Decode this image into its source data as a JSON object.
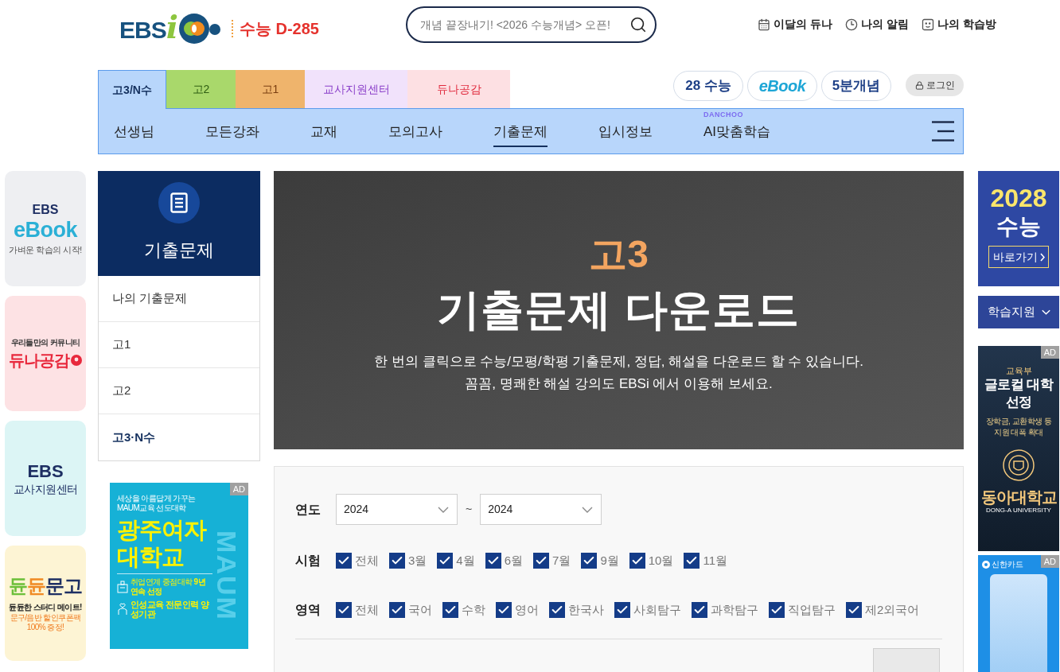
{
  "header": {
    "logo": {
      "letters": "EBS",
      "accent": "i"
    },
    "dday": "수능 D-285",
    "search": {
      "placeholder": "개념 끝장내기! <2026 수능개념> 오픈!"
    },
    "links": [
      {
        "label": "이달의 듀나"
      },
      {
        "label": "나의 알림"
      },
      {
        "label": "나의 학습방"
      }
    ]
  },
  "grade_tabs": [
    {
      "label": "고3/N수",
      "selected": true,
      "color": "#b8d6fb"
    },
    {
      "label": "고2",
      "selected": false,
      "color": "#a9d86b"
    },
    {
      "label": "고1",
      "selected": false,
      "color": "#efb46c"
    },
    {
      "label": "교사지원센터",
      "selected": false,
      "color": "#f1e2fb"
    },
    {
      "label": "듀나공감",
      "selected": false,
      "color": "#fde0e3"
    }
  ],
  "shortcuts": [
    {
      "kind": "text",
      "label": "28 수능"
    },
    {
      "kind": "logo",
      "label": "eBook"
    },
    {
      "kind": "text",
      "label": "5분개념"
    }
  ],
  "login": {
    "label": "로그인"
  },
  "main_nav": [
    {
      "label": "선생님",
      "selected": false
    },
    {
      "label": "모든강좌",
      "selected": false
    },
    {
      "label": "교재",
      "selected": false
    },
    {
      "label": "모의고사",
      "selected": false
    },
    {
      "label": "기출문제",
      "selected": true
    },
    {
      "label": "입시정보",
      "selected": false
    },
    {
      "label": "AI맞춤학습",
      "selected": false,
      "badge": "DANCHOO"
    }
  ],
  "quick_links": [
    {
      "kind": "ebook",
      "brand": "EBS",
      "title": "eBook",
      "caption": "가벼운 학습의 시작!"
    },
    {
      "kind": "community",
      "caption": "우리들만의 커뮤니티",
      "title": "듀나공감"
    },
    {
      "kind": "teacher",
      "brand": "EBS",
      "title": "교사지원센터"
    },
    {
      "kind": "bookstore",
      "title": "듄듄문고",
      "caption": "듄듄한 스터디 메이트!",
      "notes": [
        "문구/음반 할인쿠폰팩",
        "100% 증정!"
      ]
    }
  ],
  "side_menu": {
    "title": "기출문제",
    "items": [
      {
        "label": "나의 기출문제",
        "selected": false
      },
      {
        "label": "고1",
        "selected": false
      },
      {
        "label": "고2",
        "selected": false
      },
      {
        "label": "고3·N수",
        "selected": true
      }
    ]
  },
  "side_ad": {
    "badge": "AD",
    "tagline": "세상을 아름답게 가꾸는 MAUM교육 선도대학",
    "title_lines": [
      "광주여자",
      "대학교"
    ],
    "watermark": "MAUM",
    "awards": [
      {
        "text": "취업연계 중점대학 **9년 연속 선정**",
        "emphasis": false
      },
      {
        "text": "인성교육 전문인력 양성기관",
        "emphasis": true
      }
    ]
  },
  "banner": {
    "grade": "고3",
    "title": "기출문제 다운로드",
    "lines": [
      "한 번의 클릭으로 수능/모평/학평 기출문제, 정답, 해설을 다운로드 할 수 있습니다.",
      "꼼꼼, 명쾌한 해설 강의도 EBSi 에서 이용해 보세요."
    ]
  },
  "filters": {
    "year": {
      "label": "연도",
      "from": "2024",
      "separator": "~",
      "to": "2024"
    },
    "exam": {
      "label": "시험",
      "options": [
        {
          "label": "전체",
          "checked": true
        },
        {
          "label": "3월",
          "checked": true
        },
        {
          "label": "4월",
          "checked": true
        },
        {
          "label": "6월",
          "checked": true
        },
        {
          "label": "7월",
          "checked": true
        },
        {
          "label": "9월",
          "checked": true
        },
        {
          "label": "10월",
          "checked": true
        },
        {
          "label": "11월",
          "checked": true
        }
      ]
    },
    "area": {
      "label": "영역",
      "options": [
        {
          "label": "전체",
          "checked": true
        },
        {
          "label": "국어",
          "checked": true
        },
        {
          "label": "수학",
          "checked": true
        },
        {
          "label": "영어",
          "checked": true
        },
        {
          "label": "한국사",
          "checked": true
        },
        {
          "label": "사회탐구",
          "checked": true
        },
        {
          "label": "과학탐구",
          "checked": true
        },
        {
          "label": "직업탐구",
          "checked": true
        },
        {
          "label": "제2외국어",
          "checked": true
        }
      ]
    }
  },
  "right_promo": {
    "year": "2028",
    "title": "수능",
    "button": "바로가기"
  },
  "support_menu": {
    "label": "학습지원"
  },
  "univ_ad": {
    "badge": "AD",
    "org": "교육부",
    "title_lines": [
      "글로컬 대학",
      "선정"
    ],
    "lines": [
      "장학금, 교환학생 등",
      "지원 대폭 확대"
    ],
    "name": "동아대학교",
    "name_en": "DONG-A UNIVERSITY"
  },
  "card_ad": {
    "badge": "AD",
    "brand": "신한카드"
  }
}
